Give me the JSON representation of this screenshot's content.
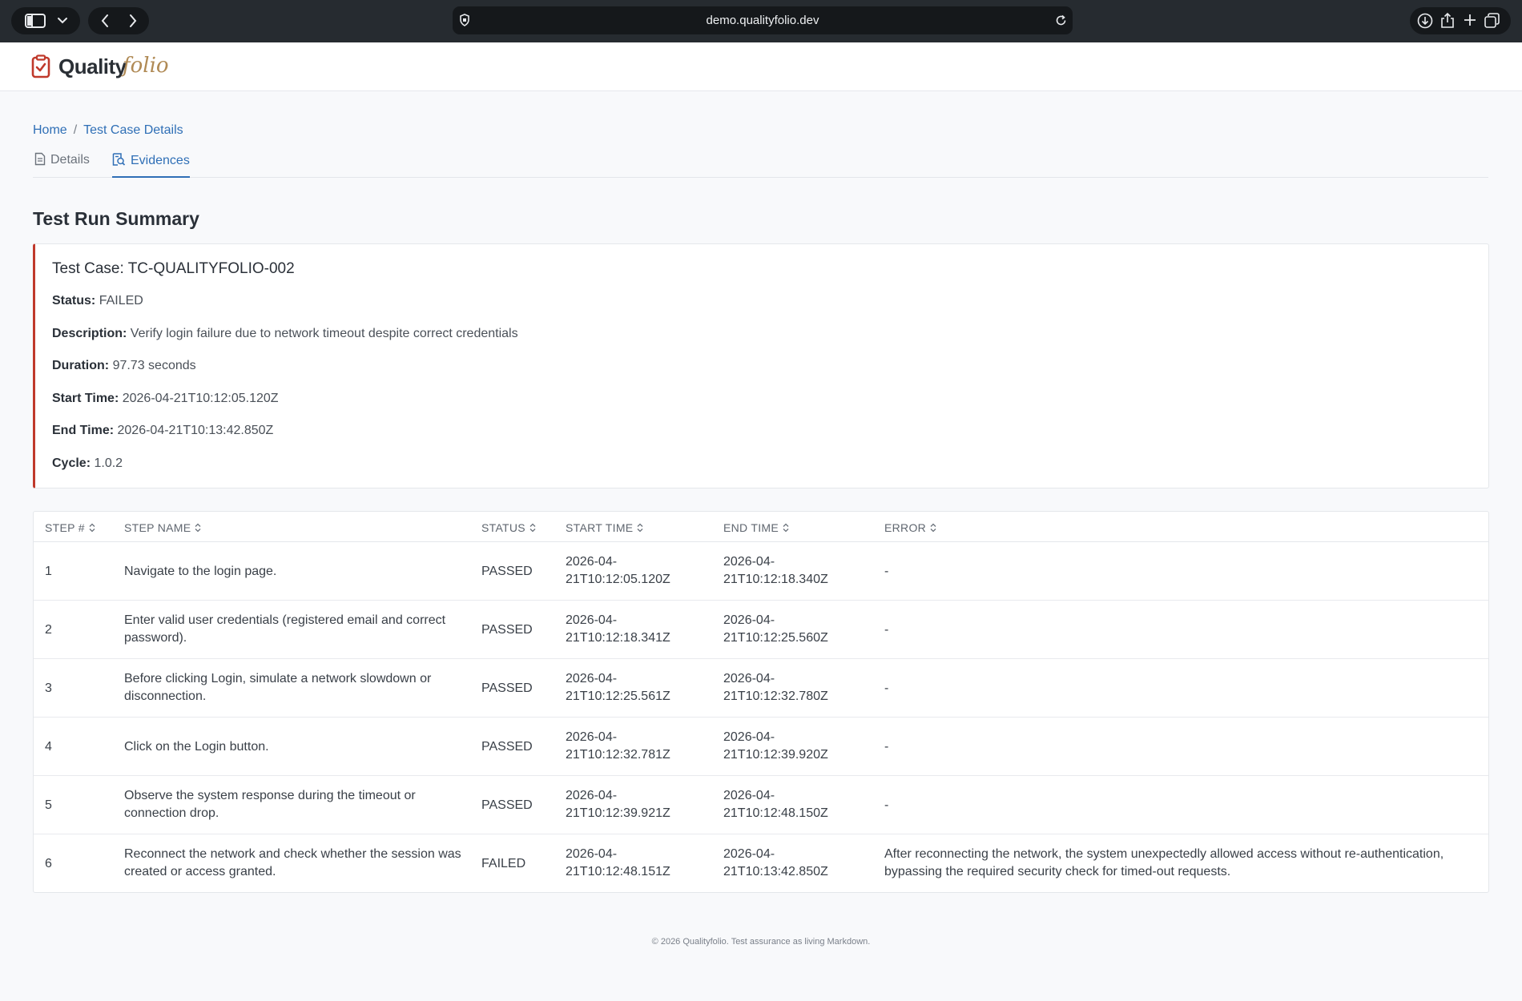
{
  "browser": {
    "url": "demo.qualityfolio.dev",
    "icons": [
      "sidebar-icon",
      "chevron-down-icon",
      "back-icon",
      "forward-icon",
      "shield-icon",
      "reload-icon",
      "download-icon",
      "share-icon",
      "new-tab-icon",
      "tabs-icon"
    ]
  },
  "app": {
    "logo_main": "Quality",
    "logo_accent": "folio",
    "brand_color": "#c0392b",
    "accent_color": "#b08a55"
  },
  "breadcrumb": {
    "home": "Home",
    "separator": "/",
    "current": "Test Case Details"
  },
  "tabs": [
    {
      "label": "Details",
      "icon": "document-icon",
      "active": false
    },
    {
      "label": "Evidences",
      "icon": "evidence-search-icon",
      "active": true
    }
  ],
  "summary": {
    "heading": "Test Run Summary",
    "title": "Test Case: TC-QUALITYFOLIO-002",
    "fields": [
      {
        "label": "Status:",
        "value": "FAILED"
      },
      {
        "label": "Description:",
        "value": "Verify login failure due to network timeout despite correct credentials"
      },
      {
        "label": "Duration:",
        "value": "97.73 seconds"
      },
      {
        "label": "Start Time:",
        "value": "2026-04-21T10:12:05.120Z"
      },
      {
        "label": "End Time:",
        "value": "2026-04-21T10:13:42.850Z"
      },
      {
        "label": "Cycle:",
        "value": "1.0.2"
      }
    ]
  },
  "table": {
    "columns": [
      "STEP #",
      "STEP NAME",
      "STATUS",
      "START TIME",
      "END TIME",
      "ERROR"
    ],
    "rows": [
      {
        "step": "1",
        "name": "Navigate to the login page.",
        "status": "PASSED",
        "start": "2026-04-21T10:12:05.120Z",
        "end": "2026-04-21T10:12:18.340Z",
        "error": "-"
      },
      {
        "step": "2",
        "name": "Enter valid user credentials (registered email and correct password).",
        "status": "PASSED",
        "start": "2026-04-21T10:12:18.341Z",
        "end": "2026-04-21T10:12:25.560Z",
        "error": "-"
      },
      {
        "step": "3",
        "name": "Before clicking Login, simulate a network slowdown or disconnection.",
        "status": "PASSED",
        "start": "2026-04-21T10:12:25.561Z",
        "end": "2026-04-21T10:12:32.780Z",
        "error": "-"
      },
      {
        "step": "4",
        "name": "Click on the Login button.",
        "status": "PASSED",
        "start": "2026-04-21T10:12:32.781Z",
        "end": "2026-04-21T10:12:39.920Z",
        "error": "-"
      },
      {
        "step": "5",
        "name": "Observe the system response during the timeout or connection drop.",
        "status": "PASSED",
        "start": "2026-04-21T10:12:39.921Z",
        "end": "2026-04-21T10:12:48.150Z",
        "error": "-"
      },
      {
        "step": "6",
        "name": "Reconnect the network and check whether the session was created or access granted.",
        "status": "FAILED",
        "start": "2026-04-21T10:12:48.151Z",
        "end": "2026-04-21T10:13:42.850Z",
        "error": "After reconnecting the network, the system unexpectedly allowed access without re-authentication, bypassing the required security check for timed-out requests."
      }
    ]
  },
  "footer": {
    "text": "© 2026 Qualityfolio. Test assurance as living Markdown."
  }
}
